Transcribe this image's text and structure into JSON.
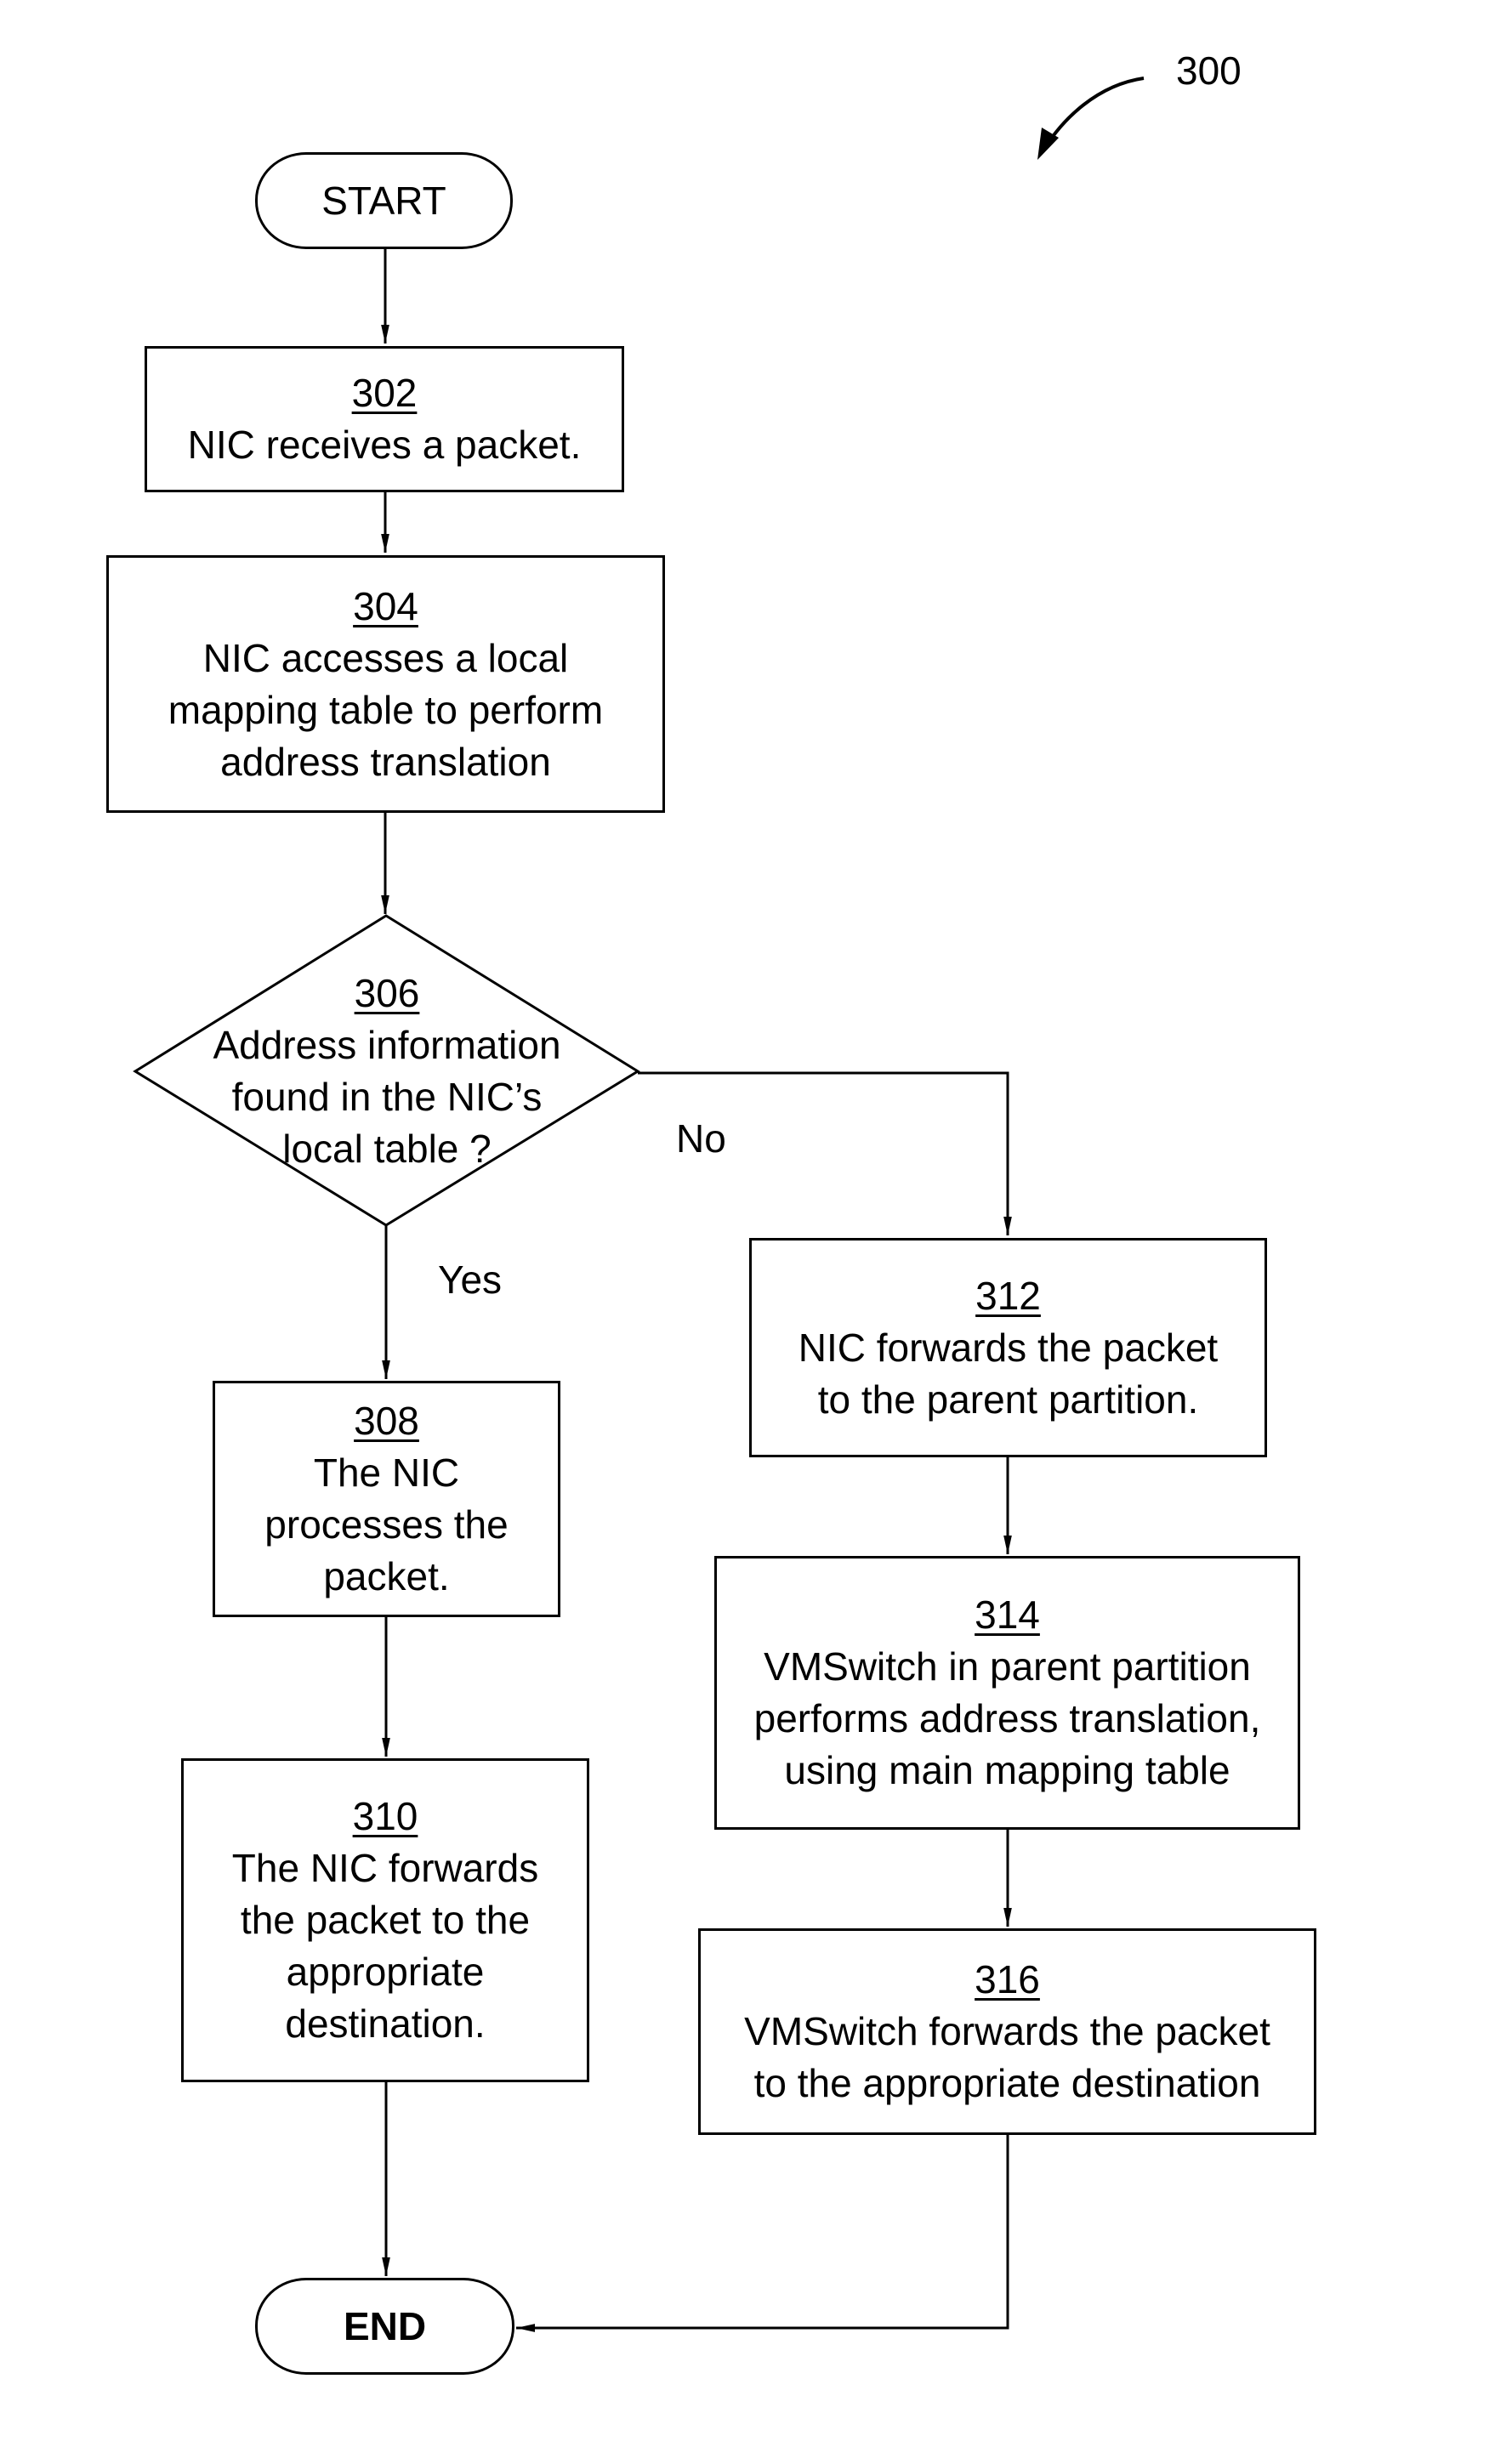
{
  "figure_ref": "300",
  "start": {
    "label": "START"
  },
  "end": {
    "label": "END"
  },
  "steps": {
    "s302": {
      "num": "302",
      "lines": [
        "NIC receives a packet."
      ]
    },
    "s304": {
      "num": "304",
      "lines": [
        "NIC accesses a local",
        "mapping table to perform",
        "address translation"
      ]
    },
    "s306": {
      "num": "306",
      "lines": [
        "Address information",
        "found in the NIC’s",
        "local table ?"
      ]
    },
    "s308": {
      "num": "308",
      "lines": [
        "The NIC",
        "processes the",
        "packet."
      ]
    },
    "s310": {
      "num": "310",
      "lines": [
        "The NIC forwards",
        "the packet to the",
        "appropriate",
        "destination."
      ]
    },
    "s312": {
      "num": "312",
      "lines": [
        "NIC forwards the packet",
        "to the parent partition."
      ]
    },
    "s314": {
      "num": "314",
      "lines": [
        "VMSwitch in parent partition",
        "performs address translation,",
        "using main mapping table"
      ]
    },
    "s316": {
      "num": "316",
      "lines": [
        "VMSwitch forwards the packet",
        "to the appropriate destination"
      ]
    }
  },
  "branches": {
    "yes": "Yes",
    "no": "No"
  }
}
